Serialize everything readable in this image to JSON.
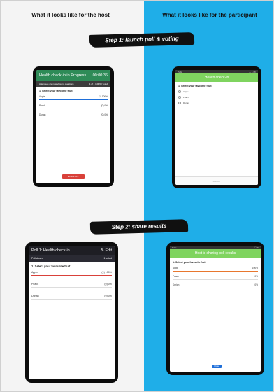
{
  "headings": {
    "host": "What it looks like for the host",
    "participant": "What it looks like for the participant"
  },
  "steps": {
    "step1": "Step 1: launch poll & voting",
    "step2": "Step 2: share results"
  },
  "host_voting": {
    "title": "Health check-in in Progress",
    "timer": "00:00:36",
    "status_left": "Attendees are now viewing questions",
    "status_right": "1 of 1 (100%) voted",
    "question": "1. Select your favourite fruit",
    "options": [
      {
        "label": "Apple",
        "result": "(1) 100%",
        "pct": 100
      },
      {
        "label": "Peach",
        "result": "(0) 0%",
        "pct": 0
      },
      {
        "label": "Durian",
        "result": "(0) 0%",
        "pct": 0
      }
    ],
    "end_poll_label": "END POLL",
    "accent": "#2e8b57",
    "bar_color": "#1f6fd9"
  },
  "participant_voting": {
    "window_title": "Polls",
    "window_controls": "— ☐ ✕",
    "header": "Health check-in",
    "question": "1. Select your favourite fruit",
    "options": [
      "Apple",
      "Peach",
      "Durian"
    ],
    "submit_label": "SUBMIT",
    "accent": "#7fd45f"
  },
  "host_results": {
    "title": "Poll 1: Health check-in",
    "edit_label": "✎ Edit",
    "status_left": "Poll closed",
    "status_right": "1 voted",
    "question": "1. Select your favourite fruit",
    "options": [
      {
        "label": "Apple",
        "result": "(1) 100%",
        "pct": 100
      },
      {
        "label": "Peach",
        "result": "(0) 0%",
        "pct": 0
      },
      {
        "label": "Durian",
        "result": "(0) 0%",
        "pct": 0
      }
    ],
    "bar_color": "#d9413a"
  },
  "participant_results": {
    "window_title": "Polls",
    "window_controls": "— ☐ ✕",
    "header": "Host is sharing poll results",
    "question": "1. Select your favourite fruit",
    "options": [
      {
        "label": "Apple",
        "result": "100%",
        "pct": 100
      },
      {
        "label": "Peach",
        "result": "0%",
        "pct": 0
      },
      {
        "label": "Durian",
        "result": "0%",
        "pct": 0
      }
    ],
    "close_label": "Close",
    "bar_color": "#e8772e"
  },
  "colors": {
    "left_bg": "#f4f4f4",
    "right_bg": "#1faee8",
    "banner": "#101010"
  }
}
